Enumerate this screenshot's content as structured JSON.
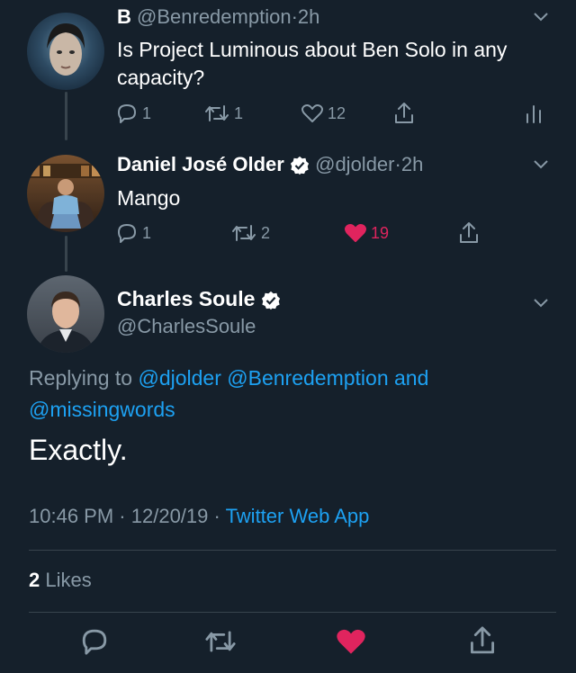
{
  "tweets": [
    {
      "display_name": "B",
      "handle": "@Benredemption",
      "time": "2h",
      "text": "Is Project Luminous about Ben Solo in any capacity?",
      "replies": "1",
      "retweets": "1",
      "likes": "12",
      "liked": false
    },
    {
      "display_name": "Daniel José Older",
      "handle": "@djolder",
      "time": "2h",
      "text": "Mango",
      "replies": "1",
      "retweets": "2",
      "likes": "19",
      "liked": true
    }
  ],
  "main": {
    "display_name": "Charles Soule",
    "handle": "@CharlesSoule",
    "replying_prefix": "Replying to",
    "mention_1": "@djolder",
    "mention_2": "@Benredemption",
    "and_word": "and",
    "mention_3": "@missingwords",
    "text": "Exactly.",
    "time": "10:46 PM",
    "date": "12/20/19",
    "source": "Twitter Web App",
    "likes_count": "2",
    "likes_label": "Likes"
  },
  "separator": "·",
  "colors": {
    "background": "#15202b",
    "muted": "#8899a6",
    "link": "#1da1f2",
    "like": "#e0245e",
    "divider": "#38444d"
  }
}
